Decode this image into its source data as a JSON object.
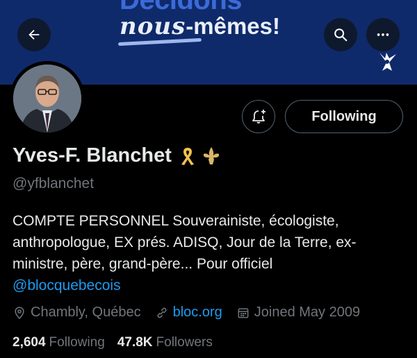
{
  "banner": {
    "line1": "Décidons",
    "line2_handwritten": "nous",
    "line2_rest": "-mêmes!"
  },
  "header": {
    "back_icon": "arrow-left-icon",
    "search_icon": "search-icon",
    "more_icon": "more-horizontal-icon"
  },
  "profile": {
    "name": "Yves-F. Blanchet",
    "name_emojis": [
      "yellow-ribbon-icon",
      "fleur-de-lis-icon"
    ],
    "handle": "@yfblanchet",
    "bio": "COMPTE PERSONNEL Souverainiste, écologiste, anthropologue, EX prés. ADISQ, Jour de la Terre, ex-ministre, père, grand-père... Pour officiel",
    "bio_mention": "@blocquebecois",
    "location": "Chambly, Québec",
    "website": "bloc.org",
    "joined": "Joined May 2009",
    "following_count": "2,604",
    "following_label": "Following",
    "followers_count": "47.8K",
    "followers_label": "Followers"
  },
  "actions": {
    "notify_icon": "bell-plus-icon",
    "following_button": "Following"
  },
  "colors": {
    "background": "#000000",
    "banner": "#0f2a6b",
    "link": "#1d9bf0",
    "secondary_text": "#71767b"
  }
}
